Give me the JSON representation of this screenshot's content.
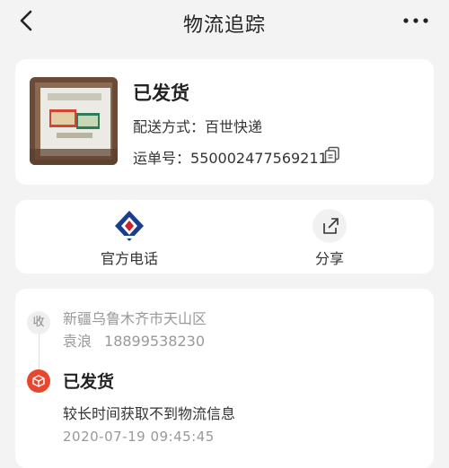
{
  "header": {
    "title": "物流追踪"
  },
  "parcel": {
    "status": "已发货",
    "shipping_method_label": "配送方式：",
    "shipping_method": "百世快递",
    "waybill_label": "运单号：",
    "waybill_number": "550002477569211"
  },
  "actions": {
    "phone_label": "官方电话",
    "share_label": "分享"
  },
  "tracking": {
    "receiver_badge": "收",
    "address": "新疆乌鲁木齐市天山区",
    "receiver_name": "袁浪",
    "receiver_phone": "18899538230",
    "status": "已发货",
    "description": "较长时间获取不到物流信息",
    "timestamp": "2020-07-19  09:45:45"
  },
  "colors": {
    "accent_red": "#e8472f",
    "courier_blue": "#1a3d8f",
    "courier_red": "#d0202e",
    "background": "#f3f3f3"
  }
}
